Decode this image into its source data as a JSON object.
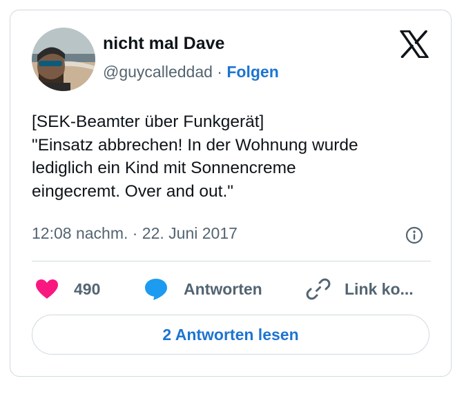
{
  "tweet": {
    "author_name": "nicht mal Dave",
    "author_handle": "@guycalleddad",
    "separator": "·",
    "follow_label": "Folgen",
    "text_lines": [
      "[SEK-Beamter über Funkgerät]",
      "\"Einsatz abbrechen! In der Wohnung wurde",
      "lediglich ein Kind mit Sonnencreme",
      "eingecremt. Over and out.\""
    ],
    "timestamp": "12:08 nachm. · 22. Juni 2017"
  },
  "actions": {
    "like_count": "490",
    "reply_label": "Antworten",
    "link_label": "Link ko..."
  },
  "footer": {
    "read_replies_label": "2 Antworten lesen"
  },
  "colors": {
    "accent": "#1d74d2",
    "like": "#f91880",
    "muted": "#536471",
    "border": "#cfd9de"
  },
  "icons": {
    "logo": "x-logo-icon",
    "info": "info-icon",
    "like": "heart-icon",
    "reply": "speech-bubble-icon",
    "link": "link-icon"
  }
}
